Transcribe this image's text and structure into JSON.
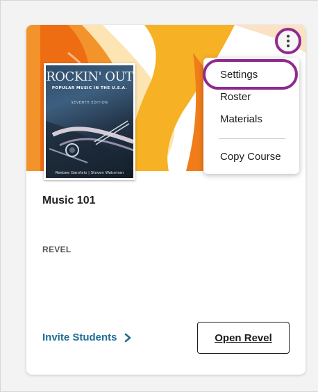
{
  "course": {
    "title": "Music 101",
    "platform": "REVEL"
  },
  "cover": {
    "title": "ROCKIN' OUT",
    "subtitle": "POPULAR MUSIC IN THE U.S.A.",
    "edition": "SEVENTH EDITION",
    "authors": "Reebee Garofalo  |  Steven Waksman"
  },
  "menu": {
    "items": [
      {
        "label": "Settings"
      },
      {
        "label": "Roster"
      },
      {
        "label": "Materials"
      },
      {
        "label": "Copy Course"
      }
    ]
  },
  "actions": {
    "invite_label": "Invite Students",
    "open_label": "Open Revel"
  },
  "colors": {
    "accent_highlight": "#8f2a8f",
    "link": "#1e6d93",
    "banner_orange": "#f07d1a",
    "banner_yellow": "#f6b124"
  }
}
